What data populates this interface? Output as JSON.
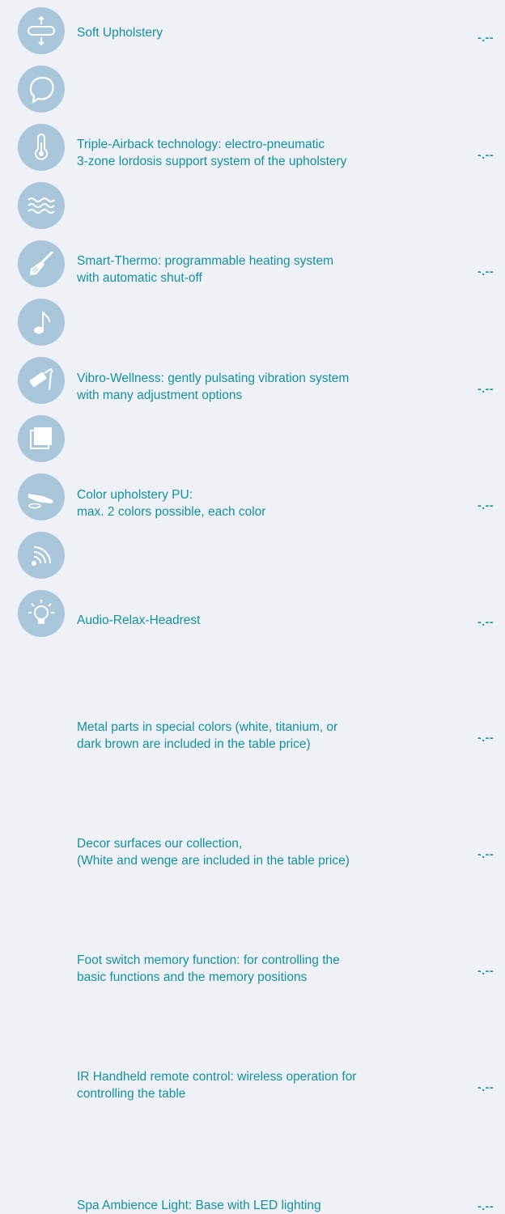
{
  "items": [
    {
      "line1": "Soft Upholstery",
      "line2": "",
      "price": "-.--",
      "icon": "upholstery-expand-icon"
    },
    {
      "line1": "Triple-Airback technology: electro-pneumatic",
      "line2": "3-zone lordosis support system of the upholstery",
      "price": "-.--",
      "icon": "air-bubble-icon"
    },
    {
      "line1": "Smart-Thermo: programmable heating system",
      "line2": "with automatic shut-off",
      "price": "-.--",
      "icon": "thermometer-icon"
    },
    {
      "line1": "Vibro-Wellness: gently pulsating vibration system",
      "line2": "with many adjustment options",
      "price": "-.--",
      "icon": "waves-icon"
    },
    {
      "line1": "Color upholstery PU:",
      "line2": "max. 2 colors possible, each color",
      "price": "-.--",
      "icon": "paintbrush-icon"
    },
    {
      "line1": "Audio-Relax-Headrest",
      "line2": "",
      "price": "-.--",
      "icon": "music-note-icon"
    },
    {
      "line1": "Metal parts in special colors (white, titanium, or",
      "line2": "dark brown are included in the table price)",
      "price": "-.--",
      "icon": "paint-roller-icon"
    },
    {
      "line1": "Decor surfaces  our collection,",
      "line2": "(White and wenge are included in the table price)",
      "price": "-.--",
      "icon": "decor-square-icon"
    },
    {
      "line1": "Foot switch memory function: for controlling the",
      "line2": "basic functions and the memory positions",
      "price": "-.--",
      "icon": "foot-switch-icon"
    },
    {
      "line1": "IR Handheld remote control: wireless operation for",
      "line2": "controlling the table",
      "price": "-.--",
      "icon": "remote-signal-icon"
    },
    {
      "line1": "Spa Ambience Light: Base with LED lighting",
      "line2": "",
      "price": "-.--",
      "icon": "light-bulb-icon"
    }
  ]
}
